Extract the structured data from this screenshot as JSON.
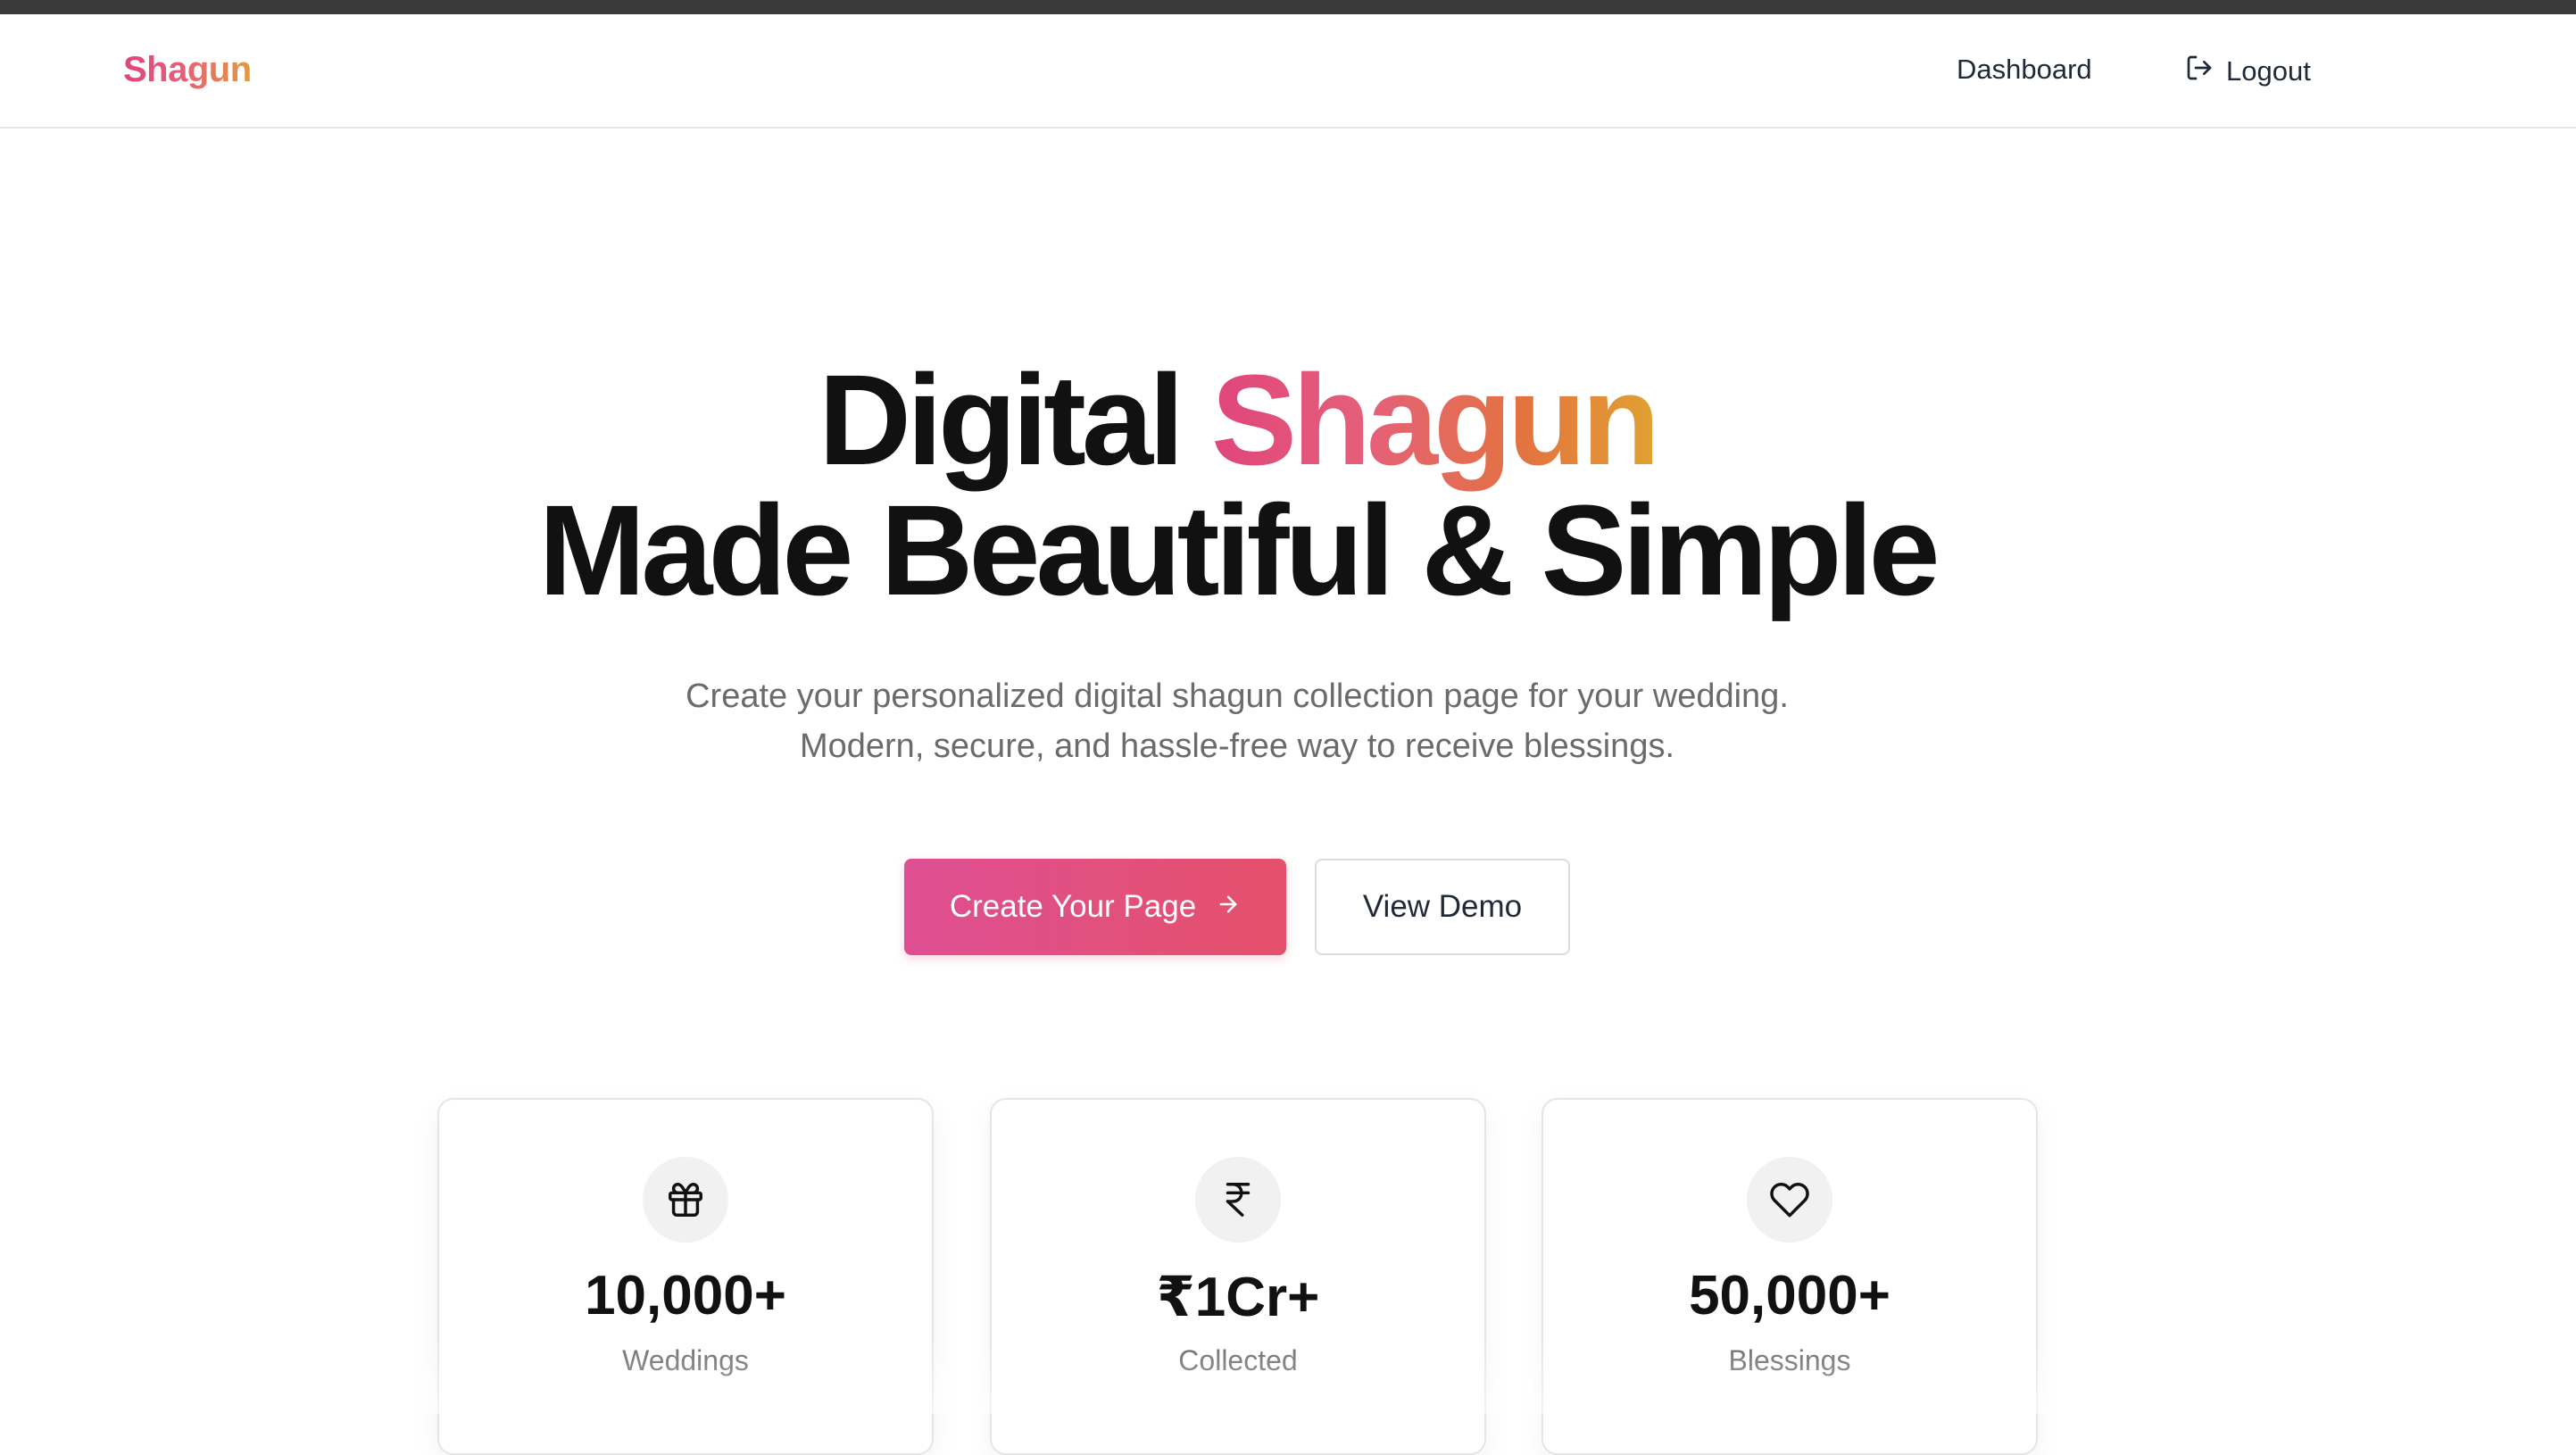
{
  "navbar": {
    "logo": "Shagun",
    "links": {
      "dashboard": "Dashboard",
      "logout": "Logout"
    },
    "logout_icon": "logout-icon"
  },
  "hero": {
    "title_line1_plain": "Digital ",
    "title_line1_accent": "Shagun",
    "title_line2": "Made Beautiful & Simple",
    "subtitle_line1": "Create your personalized digital shagun collection page for your wedding.",
    "subtitle_line2": "Modern, secure, and hassle-free way to receive blessings."
  },
  "actions": {
    "primary_label": "Create Your Page",
    "primary_icon": "arrow-right-icon",
    "secondary_label": "View Demo"
  },
  "stats": [
    {
      "icon": "gift-icon",
      "value": "10,000+",
      "label": "Weddings"
    },
    {
      "icon": "rupee-icon",
      "value": "₹1Cr+",
      "label": "Collected"
    },
    {
      "icon": "heart-icon",
      "value": "50,000+",
      "label": "Blessings"
    }
  ],
  "colors": {
    "brand_pink": "#e0457b",
    "brand_orange": "#e0a232",
    "primary_button_start": "#de4f93",
    "primary_button_end": "#e5506a",
    "text_dark": "#111111",
    "text_muted": "#6b6b6b"
  }
}
